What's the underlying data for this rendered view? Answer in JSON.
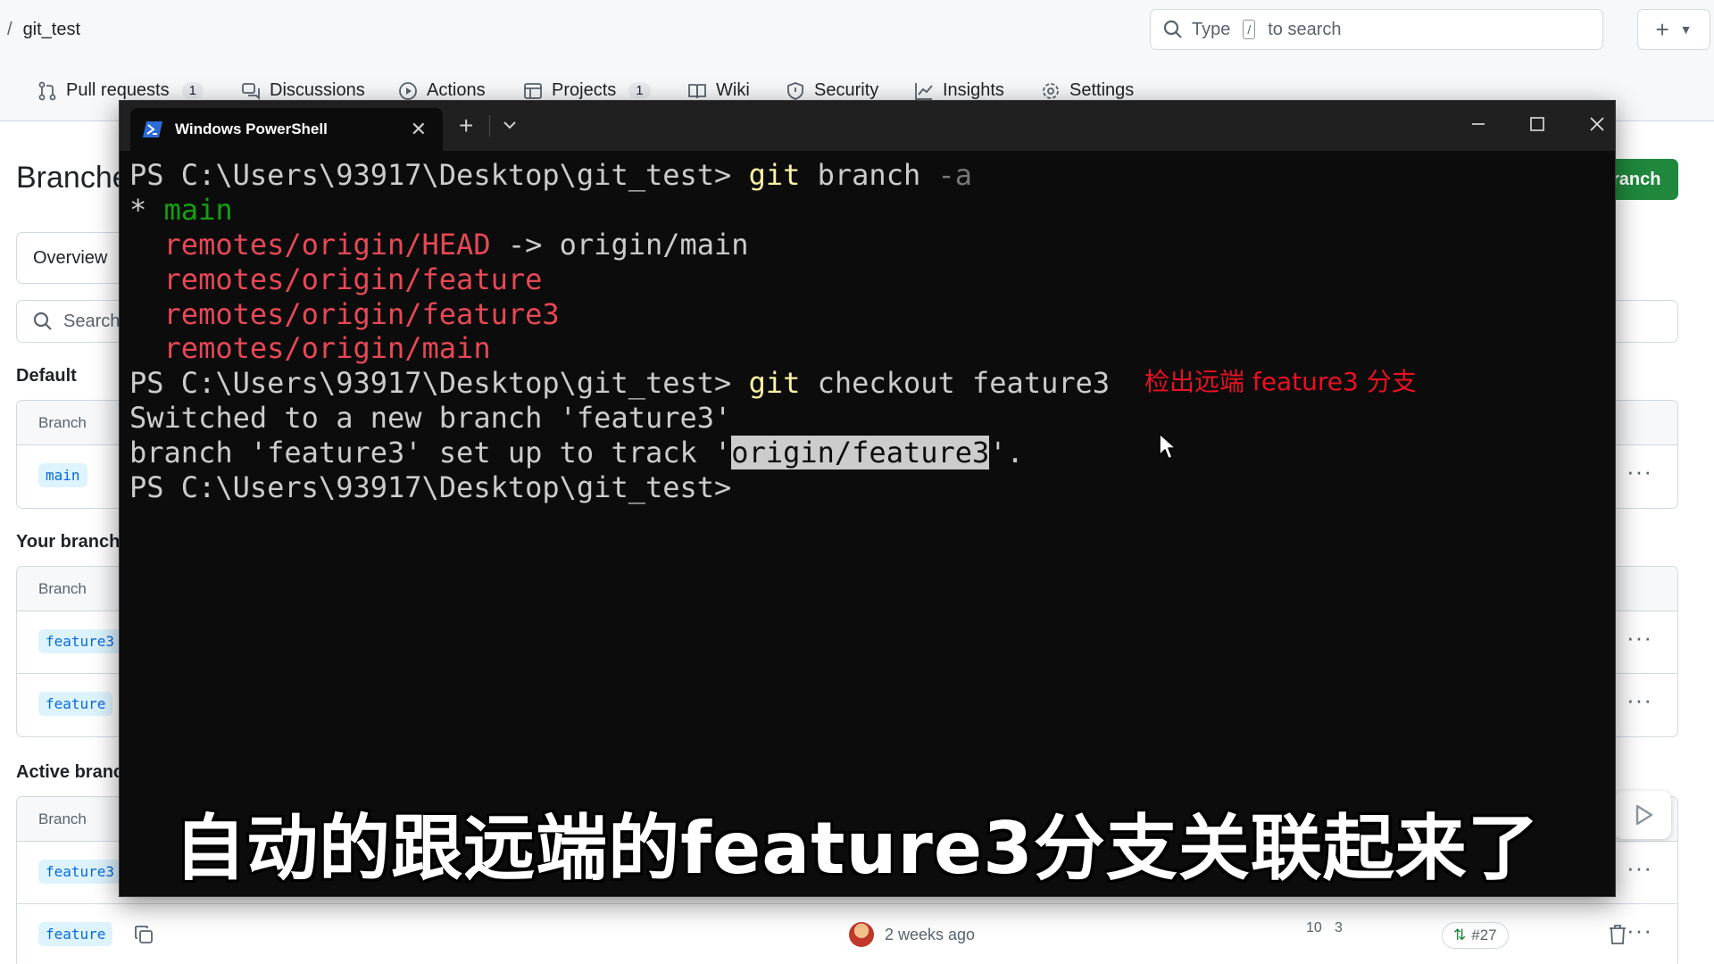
{
  "github": {
    "breadcrumb": {
      "separator": "/",
      "repo": "git_test"
    },
    "search": {
      "prefix": "Type",
      "key": "/",
      "suffix": "to search"
    },
    "plus_label": "+",
    "tabs": [
      {
        "label": "Pull requests",
        "count": "1",
        "icon": "git-pull-request-icon"
      },
      {
        "label": "Discussions",
        "icon": "discussions-icon"
      },
      {
        "label": "Actions",
        "icon": "play-circle-icon"
      },
      {
        "label": "Projects",
        "count": "1",
        "icon": "table-icon"
      },
      {
        "label": "Wiki",
        "icon": "book-icon"
      },
      {
        "label": "Security",
        "icon": "shield-icon"
      },
      {
        "label": "Insights",
        "icon": "graph-icon"
      },
      {
        "label": "Settings",
        "icon": "gear-icon"
      }
    ],
    "page_title": "Branche",
    "new_branch_label": "ranch",
    "overview_tab": "Overview",
    "search_placeholder": "Search",
    "sections": {
      "default": {
        "label": "Default",
        "header": "Branch",
        "rows": [
          {
            "name": "main"
          }
        ]
      },
      "yours": {
        "label": "Your branche",
        "header": "Branch",
        "rows": [
          {
            "name": "feature3"
          },
          {
            "name": "feature"
          }
        ]
      },
      "active": {
        "label": "Active branc",
        "header": "Branch",
        "rows": [
          {
            "name": "feature3"
          },
          {
            "name": "feature",
            "updated": "2 weeks ago",
            "behind": "10",
            "ahead": "3",
            "pr": "#27"
          }
        ]
      }
    },
    "colors": {
      "accent_green": "#1f883d",
      "pill_bg": "#ddf4ff",
      "pill_text": "#0969da"
    }
  },
  "powershell": {
    "tab_title": "Windows PowerShell",
    "lines": [
      {
        "parts": [
          {
            "t": "PS C:\\Users\\93917\\Desktop\\git_test> ",
            "c": ""
          },
          {
            "t": "git",
            "c": "yellow"
          },
          {
            "t": " branch ",
            "c": ""
          },
          {
            "t": "-a",
            "c": "gray"
          }
        ]
      },
      {
        "parts": [
          {
            "t": "* ",
            "c": ""
          },
          {
            "t": "main",
            "c": "green"
          }
        ]
      },
      {
        "parts": [
          {
            "t": "  ",
            "c": ""
          },
          {
            "t": "remotes/origin/HEAD",
            "c": "red"
          },
          {
            "t": " -> origin/main",
            "c": ""
          }
        ]
      },
      {
        "parts": [
          {
            "t": "  ",
            "c": ""
          },
          {
            "t": "remotes/origin/feature",
            "c": "red"
          }
        ]
      },
      {
        "parts": [
          {
            "t": "  ",
            "c": ""
          },
          {
            "t": "remotes/origin/feature3",
            "c": "red"
          }
        ]
      },
      {
        "parts": [
          {
            "t": "  ",
            "c": ""
          },
          {
            "t": "remotes/origin/main",
            "c": "red"
          }
        ]
      },
      {
        "parts": [
          {
            "t": "PS C:\\Users\\93917\\Desktop\\git_test> ",
            "c": ""
          },
          {
            "t": "git",
            "c": "yellow"
          },
          {
            "t": " checkout feature3",
            "c": ""
          }
        ]
      },
      {
        "parts": [
          {
            "t": "Switched to a new branch 'feature3'",
            "c": ""
          }
        ]
      },
      {
        "parts": [
          {
            "t": "branch 'feature3' set up to track '",
            "c": ""
          },
          {
            "t": "origin/feature3",
            "c": "sel"
          },
          {
            "t": "'.",
            "c": ""
          }
        ]
      },
      {
        "parts": [
          {
            "t": "PS C:\\Users\\93917\\Desktop\\git_test>",
            "c": ""
          }
        ]
      }
    ],
    "colors": {
      "background": "#0c0c0c",
      "text": "#cccccc",
      "command": "#f9f1a5",
      "current_branch": "#13a10e",
      "remote_branch": "#e74856"
    }
  },
  "annotation": "检出远端 feature3 分支",
  "subtitle": "自动的跟远端的feature3分支关联起来了"
}
